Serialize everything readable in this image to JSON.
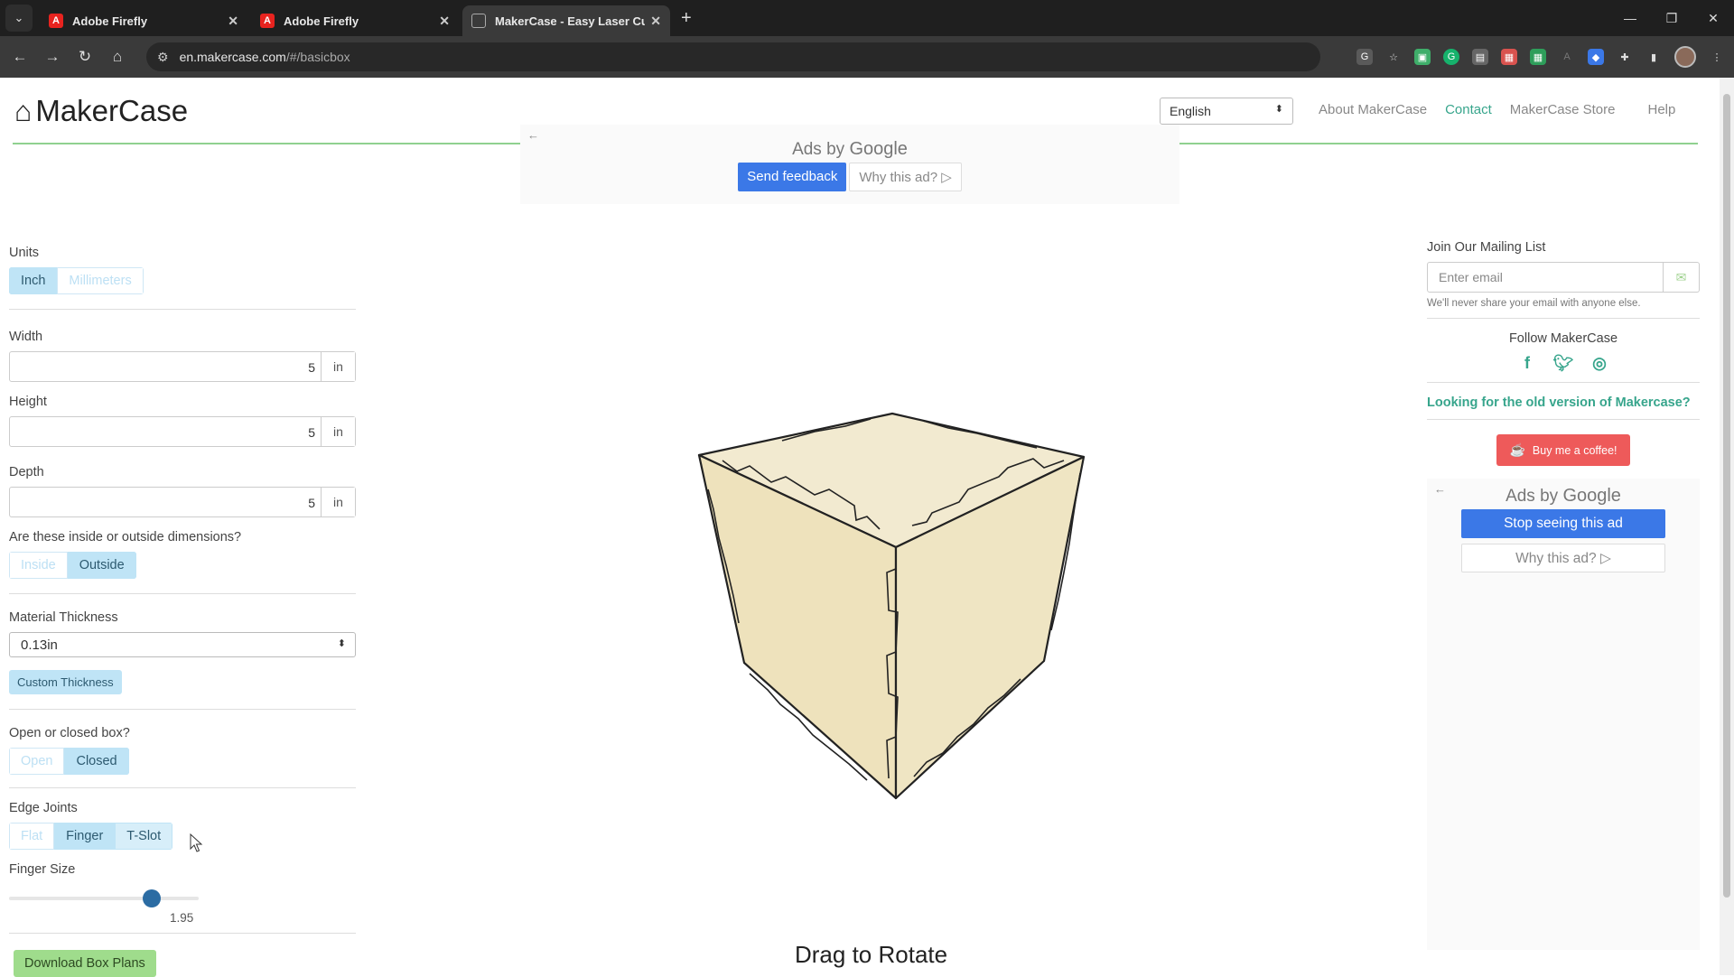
{
  "browser": {
    "tabs": [
      {
        "title": "Adobe Firefly"
      },
      {
        "title": "Adobe Firefly"
      },
      {
        "title": "MakerCase - Easy Laser Cut Ca"
      }
    ],
    "url_host": "en.makercase.com",
    "url_path": "/#/basicbox"
  },
  "header": {
    "logo_text": "MakerCase",
    "language": "English",
    "nav": [
      "About MakerCase",
      "Contact",
      "MakerCase Store",
      "Help"
    ]
  },
  "ad_top": {
    "ads_by": "Ads by",
    "google": "Google",
    "send_feedback": "Send feedback",
    "why": "Why this ad? ▷"
  },
  "config": {
    "units_label": "Units",
    "units": [
      "Inch",
      "Millimeters"
    ],
    "width_label": "Width",
    "width_value": "5",
    "height_label": "Height",
    "height_value": "5",
    "depth_label": "Depth",
    "depth_value": "5",
    "unit_suffix": "in",
    "dim_question": "Are these inside or outside dimensions?",
    "dim_options": [
      "Inside",
      "Outside"
    ],
    "thickness_label": "Material Thickness",
    "thickness_value": "0.13in",
    "custom_thickness": "Custom Thickness",
    "open_question": "Open or closed box?",
    "open_options": [
      "Open",
      "Closed"
    ],
    "edge_label": "Edge Joints",
    "edge_options": [
      "Flat",
      "Finger",
      "T-Slot"
    ],
    "finger_label": "Finger Size",
    "finger_value": "1.95",
    "finger_fraction": 0.78,
    "download": "Download Box Plans"
  },
  "viewer": {
    "hint": "Drag to Rotate"
  },
  "sidebar": {
    "mailing_label": "Join Our Mailing List",
    "email_placeholder": "Enter email",
    "privacy_note": "We'll never share your email with anyone else.",
    "follow": "Follow MakerCase",
    "old_version": "Looking for the old version of Makercase?",
    "coffee": "Buy me a coffee!",
    "ad_ads_by": "Ads by",
    "ad_google": "Google",
    "stop_seeing": "Stop seeing this ad",
    "why": "Why this ad? ▷"
  },
  "colors": {
    "accent_green": "#37a58c",
    "active_button": "#bfe4f6",
    "cube_fill": "#efe6c4"
  }
}
